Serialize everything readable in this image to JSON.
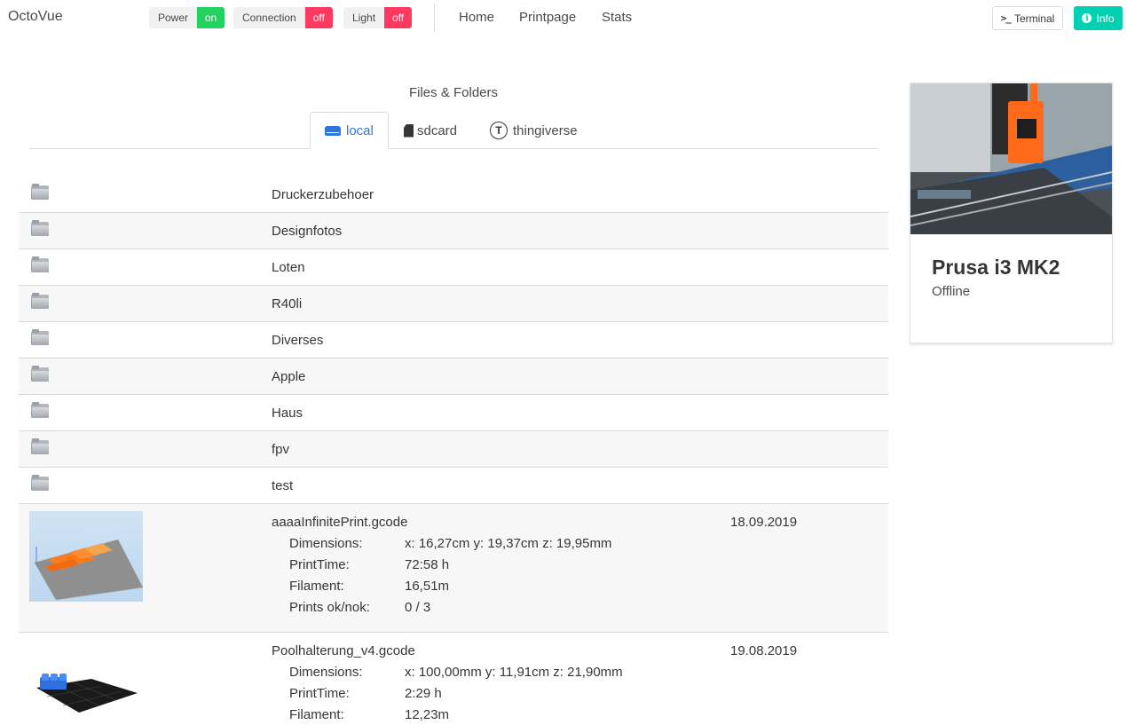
{
  "app": {
    "brand": "OctoVue"
  },
  "toggles": [
    {
      "label": "Power",
      "state": "on"
    },
    {
      "label": "Connection",
      "state": "off"
    },
    {
      "label": "Light",
      "state": "off"
    }
  ],
  "nav": {
    "home": "Home",
    "printpage": "Printpage",
    "stats": "Stats"
  },
  "buttons": {
    "terminal": "Terminal",
    "info": "Info"
  },
  "files": {
    "title": "Files & Folders",
    "tabs": [
      {
        "label": "local",
        "icon": "hdd-icon",
        "active": true
      },
      {
        "label": "sdcard",
        "icon": "sdcard-icon",
        "active": false
      },
      {
        "label": "thingiverse",
        "icon": "thingiverse-icon",
        "active": false
      }
    ],
    "folders": [
      "Druckerzubehoer",
      "Designfotos",
      "Loten",
      "R40li",
      "Diverses",
      "Apple",
      "Haus",
      "fpv",
      "test"
    ],
    "items": [
      {
        "name": "aaaaInfinitePrint.gcode",
        "date": "18.09.2019",
        "dimensions_label": "Dimensions:",
        "dimensions": "x: 16,27cm y: 19,37cm z: 19,95mm",
        "printtime_label": "PrintTime:",
        "printtime": "72:58 h",
        "filament_label": "Filament:",
        "filament": "16,51m",
        "prints_label": "Prints ok/nok:",
        "prints": "0 / 3"
      },
      {
        "name": "Poolhalterung_v4.gcode",
        "date": "19.08.2019",
        "dimensions_label": "Dimensions:",
        "dimensions": "x: 100,00mm y: 11,91cm z: 21,90mm",
        "printtime_label": "PrintTime:",
        "printtime": "2:29 h",
        "filament_label": "Filament:",
        "filament": "12,23m"
      }
    ]
  },
  "printer": {
    "name": "Prusa i3 MK2",
    "status": "Offline"
  },
  "colors": {
    "on": "#23d160",
    "off": "#ff3860",
    "info": "#00d1b2",
    "link": "#3273dc"
  }
}
